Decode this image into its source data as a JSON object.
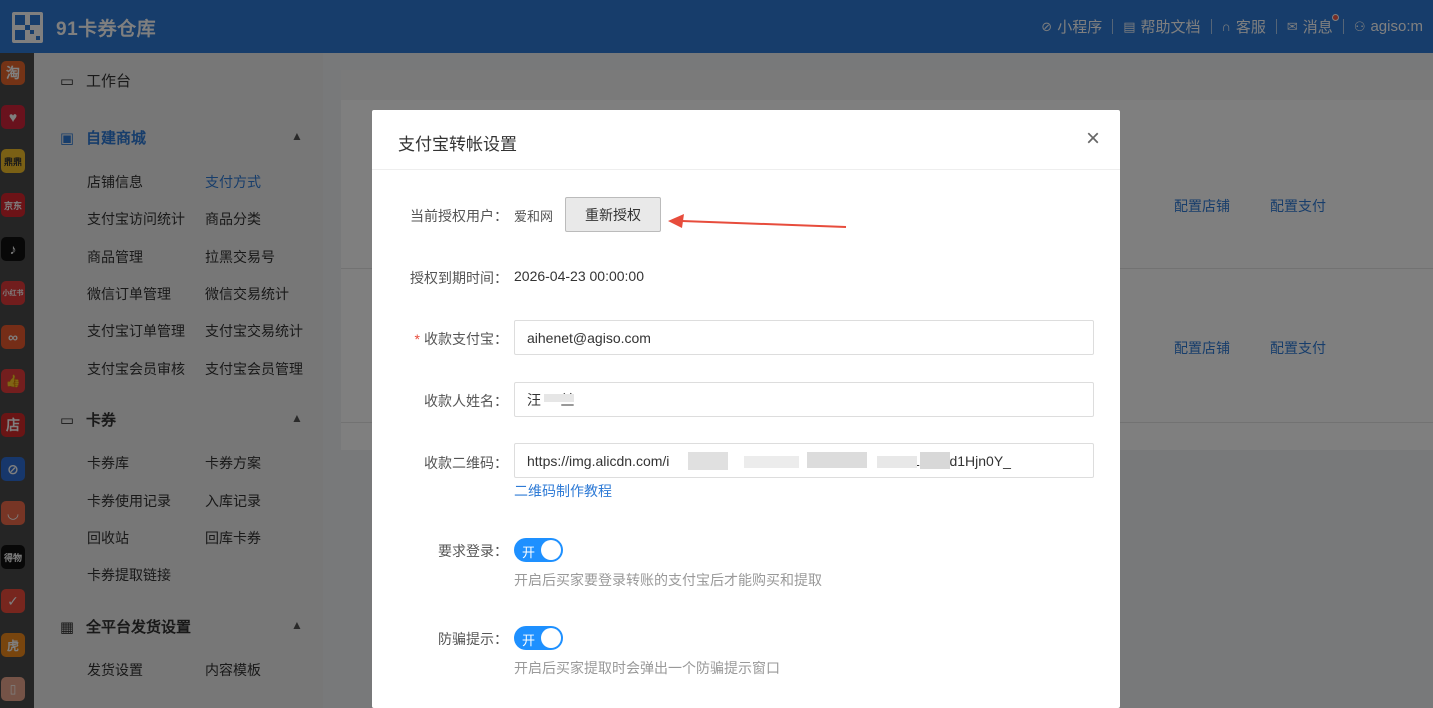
{
  "header": {
    "app_title": "91卡券仓库",
    "nav": [
      {
        "label": "小程序",
        "icon": "miniprogram-icon"
      },
      {
        "label": "帮助文档",
        "icon": "document-icon"
      },
      {
        "label": "客服",
        "icon": "headset-icon"
      },
      {
        "label": "消息",
        "icon": "mail-icon"
      },
      {
        "label": "agiso:m",
        "icon": "user-icon"
      }
    ]
  },
  "rail": {
    "icons": [
      {
        "name": "taobao",
        "text": "淘",
        "color": "#e8662c"
      },
      {
        "name": "red-heart",
        "text": "♥",
        "color": "#d3243a"
      },
      {
        "name": "dangdang",
        "text": "鼎鼎",
        "color": "#f4c12a"
      },
      {
        "name": "jd",
        "text": "京东",
        "color": "#d8272f"
      },
      {
        "name": "douyin",
        "text": "♪",
        "color": "#111111"
      },
      {
        "name": "xiaohongshu",
        "text": "小红书",
        "color": "#e33b3b"
      },
      {
        "name": "circle-app",
        "text": "∞",
        "color": "#ea5a2f"
      },
      {
        "name": "thumb-app",
        "text": "👍",
        "color": "#e73c3c"
      },
      {
        "name": "shop-app",
        "text": "店",
        "color": "#d52b2b"
      },
      {
        "name": "link-app",
        "text": "⊘",
        "color": "#2f6fd6"
      },
      {
        "name": "face-app",
        "text": "◡",
        "color": "#ef6a4a"
      },
      {
        "name": "dewu",
        "text": "得物",
        "color": "#111111"
      },
      {
        "name": "check-app",
        "text": "✓",
        "color": "#ee4d3d"
      },
      {
        "name": "tiger-app",
        "text": "虎",
        "color": "#f08a1c"
      },
      {
        "name": "clip-app",
        "text": "▯",
        "color": "#eaa78e"
      }
    ]
  },
  "sidenav": {
    "workbench": "工作台",
    "groups": [
      {
        "title": "自建商城",
        "items": [
          "店铺信息",
          "支付方式",
          "支付宝访问统计",
          "商品分类",
          "商品管理",
          "拉黑交易号",
          "微信订单管理",
          "微信交易统计",
          "支付宝订单管理",
          "支付宝交易统计",
          "支付宝会员审核",
          "支付宝会员管理"
        ]
      },
      {
        "title": "卡券",
        "items": [
          "卡券库",
          "卡券方案",
          "卡券使用记录",
          "入库记录",
          "回收站",
          "回库卡券",
          "卡券提取链接"
        ]
      },
      {
        "title": "全平台发货设置",
        "items": [
          "发货设置",
          "内容模板"
        ]
      }
    ]
  },
  "background": {
    "links": [
      "配置店铺",
      "配置支付",
      "配置店铺",
      "配置支付"
    ]
  },
  "modal": {
    "title": "支付宝转帐设置",
    "close_symbol": "×",
    "auth_user_label": "当前授权用户：",
    "auth_user_value": "爱和网",
    "reauth_button": "重新授权",
    "expire_label": "授权到期时间：",
    "expire_value": "2026-04-23 00:00:00",
    "alipay_label": "收款支付宝：",
    "alipay_value": "aihenet@agiso.com",
    "payee_label": "收款人姓名：",
    "payee_value": "汪     兰",
    "qr_label": "收款二维码：",
    "qr_value": "https://img.alicdn.com/i                                                       4W61OaGd1Hjn0Y_",
    "qr_help_link": "二维码制作教程",
    "login_label": "要求登录：",
    "login_toggle": "开",
    "login_hint": "开启后买家要登录转账的支付宝后才能购买和提取",
    "fraud_label": "防骗提示：",
    "fraud_toggle": "开",
    "fraud_hint": "开启后买家提取时会弹出一个防骗提示窗口"
  },
  "colors": {
    "brand": "#2f7bd6",
    "toggle_on": "#1e90ff",
    "annotation_arrow": "#e74c3c"
  }
}
